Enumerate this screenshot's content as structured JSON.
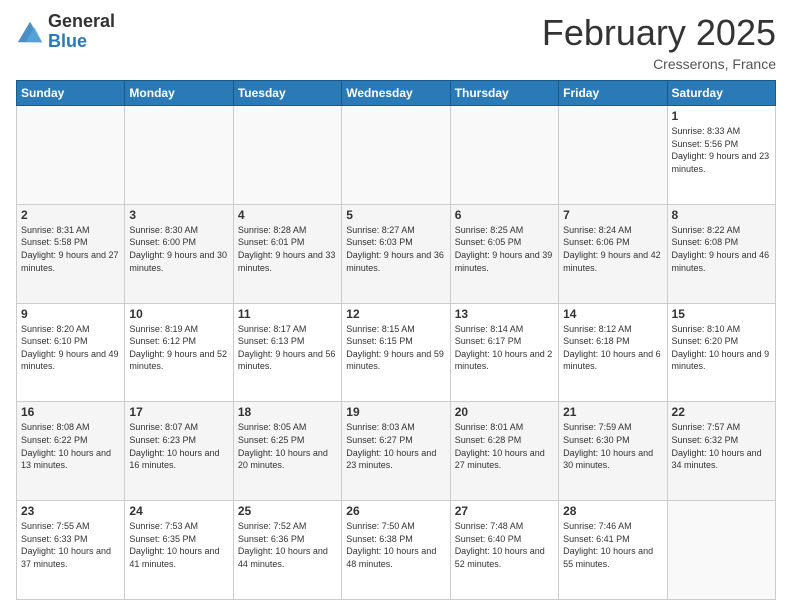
{
  "logo": {
    "general": "General",
    "blue": "Blue"
  },
  "header": {
    "month": "February 2025",
    "location": "Cresserons, France"
  },
  "days_of_week": [
    "Sunday",
    "Monday",
    "Tuesday",
    "Wednesday",
    "Thursday",
    "Friday",
    "Saturday"
  ],
  "weeks": [
    [
      {
        "day": "",
        "info": ""
      },
      {
        "day": "",
        "info": ""
      },
      {
        "day": "",
        "info": ""
      },
      {
        "day": "",
        "info": ""
      },
      {
        "day": "",
        "info": ""
      },
      {
        "day": "",
        "info": ""
      },
      {
        "day": "1",
        "info": "Sunrise: 8:33 AM\nSunset: 5:56 PM\nDaylight: 9 hours and 23 minutes."
      }
    ],
    [
      {
        "day": "2",
        "info": "Sunrise: 8:31 AM\nSunset: 5:58 PM\nDaylight: 9 hours and 27 minutes."
      },
      {
        "day": "3",
        "info": "Sunrise: 8:30 AM\nSunset: 6:00 PM\nDaylight: 9 hours and 30 minutes."
      },
      {
        "day": "4",
        "info": "Sunrise: 8:28 AM\nSunset: 6:01 PM\nDaylight: 9 hours and 33 minutes."
      },
      {
        "day": "5",
        "info": "Sunrise: 8:27 AM\nSunset: 6:03 PM\nDaylight: 9 hours and 36 minutes."
      },
      {
        "day": "6",
        "info": "Sunrise: 8:25 AM\nSunset: 6:05 PM\nDaylight: 9 hours and 39 minutes."
      },
      {
        "day": "7",
        "info": "Sunrise: 8:24 AM\nSunset: 6:06 PM\nDaylight: 9 hours and 42 minutes."
      },
      {
        "day": "8",
        "info": "Sunrise: 8:22 AM\nSunset: 6:08 PM\nDaylight: 9 hours and 46 minutes."
      }
    ],
    [
      {
        "day": "9",
        "info": "Sunrise: 8:20 AM\nSunset: 6:10 PM\nDaylight: 9 hours and 49 minutes."
      },
      {
        "day": "10",
        "info": "Sunrise: 8:19 AM\nSunset: 6:12 PM\nDaylight: 9 hours and 52 minutes."
      },
      {
        "day": "11",
        "info": "Sunrise: 8:17 AM\nSunset: 6:13 PM\nDaylight: 9 hours and 56 minutes."
      },
      {
        "day": "12",
        "info": "Sunrise: 8:15 AM\nSunset: 6:15 PM\nDaylight: 9 hours and 59 minutes."
      },
      {
        "day": "13",
        "info": "Sunrise: 8:14 AM\nSunset: 6:17 PM\nDaylight: 10 hours and 2 minutes."
      },
      {
        "day": "14",
        "info": "Sunrise: 8:12 AM\nSunset: 6:18 PM\nDaylight: 10 hours and 6 minutes."
      },
      {
        "day": "15",
        "info": "Sunrise: 8:10 AM\nSunset: 6:20 PM\nDaylight: 10 hours and 9 minutes."
      }
    ],
    [
      {
        "day": "16",
        "info": "Sunrise: 8:08 AM\nSunset: 6:22 PM\nDaylight: 10 hours and 13 minutes."
      },
      {
        "day": "17",
        "info": "Sunrise: 8:07 AM\nSunset: 6:23 PM\nDaylight: 10 hours and 16 minutes."
      },
      {
        "day": "18",
        "info": "Sunrise: 8:05 AM\nSunset: 6:25 PM\nDaylight: 10 hours and 20 minutes."
      },
      {
        "day": "19",
        "info": "Sunrise: 8:03 AM\nSunset: 6:27 PM\nDaylight: 10 hours and 23 minutes."
      },
      {
        "day": "20",
        "info": "Sunrise: 8:01 AM\nSunset: 6:28 PM\nDaylight: 10 hours and 27 minutes."
      },
      {
        "day": "21",
        "info": "Sunrise: 7:59 AM\nSunset: 6:30 PM\nDaylight: 10 hours and 30 minutes."
      },
      {
        "day": "22",
        "info": "Sunrise: 7:57 AM\nSunset: 6:32 PM\nDaylight: 10 hours and 34 minutes."
      }
    ],
    [
      {
        "day": "23",
        "info": "Sunrise: 7:55 AM\nSunset: 6:33 PM\nDaylight: 10 hours and 37 minutes."
      },
      {
        "day": "24",
        "info": "Sunrise: 7:53 AM\nSunset: 6:35 PM\nDaylight: 10 hours and 41 minutes."
      },
      {
        "day": "25",
        "info": "Sunrise: 7:52 AM\nSunset: 6:36 PM\nDaylight: 10 hours and 44 minutes."
      },
      {
        "day": "26",
        "info": "Sunrise: 7:50 AM\nSunset: 6:38 PM\nDaylight: 10 hours and 48 minutes."
      },
      {
        "day": "27",
        "info": "Sunrise: 7:48 AM\nSunset: 6:40 PM\nDaylight: 10 hours and 52 minutes."
      },
      {
        "day": "28",
        "info": "Sunrise: 7:46 AM\nSunset: 6:41 PM\nDaylight: 10 hours and 55 minutes."
      },
      {
        "day": "",
        "info": ""
      }
    ]
  ]
}
